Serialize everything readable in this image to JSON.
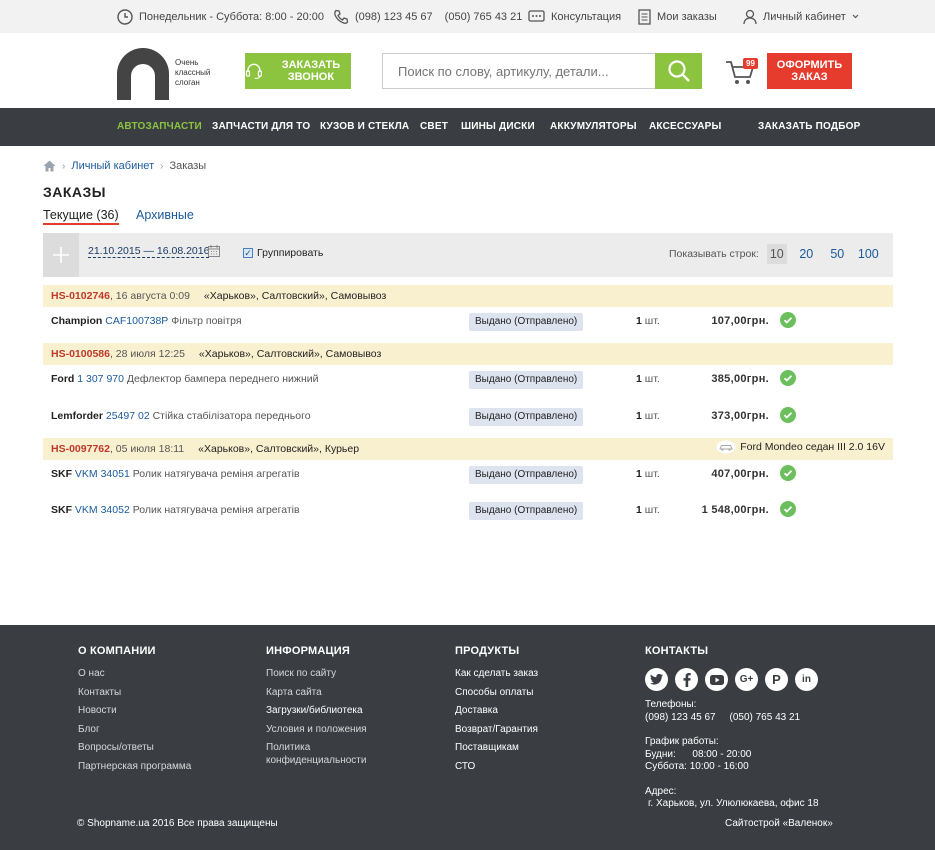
{
  "topbar": {
    "hours": "Понедельник - Суббота: 8:00 - 20:00",
    "phone1": "(098) 123 45 67",
    "phone2": "(050) 765 43 21",
    "consult": "Консультация",
    "my_orders": "Мои заказы",
    "account": "Личный кабинет"
  },
  "header": {
    "slogan": "Очень\nклассный\nслоган",
    "call_btn": "Заказать звонок",
    "search_placeholder": "Поиск по слову, артикулу, детали...",
    "cart_count": "99",
    "order_btn": "Оформить заказ"
  },
  "nav": {
    "items": [
      "АВТОЗАПЧАСТИ",
      "ЗАПЧАСТИ ДЛЯ ТО",
      "КУЗОВ И СТЕКЛА",
      "СВЕТ",
      "ШИНЫ ДИСКИ",
      "АККУМУЛЯТОРЫ",
      "АКСЕССУАРЫ"
    ],
    "right": "ЗАКАЗАТЬ ПОДБОР",
    "active_color": "#8cc43f"
  },
  "breadcrumb": {
    "home": "home",
    "account": "Личный кабинет",
    "current": "Заказы"
  },
  "page_title": "ЗАКАЗЫ",
  "tabs": {
    "current": "Текущие (36)",
    "archive": "Архивные"
  },
  "filter": {
    "date_range": "21.10.2015 — 16.08.2016",
    "group_label": "Группировать",
    "rows_label": "Показывать строк:",
    "rows_options": [
      "10",
      "20",
      "50",
      "100"
    ]
  },
  "orders": [
    {
      "num": "HS-0102746",
      "date": ", 16 августа 0:09",
      "addr": "«Харьков», Салтовский», Самовывоз",
      "car": "",
      "items": [
        {
          "brand": "Champion",
          "art": "CAF100738P",
          "desc": "Фільтр повітря",
          "status": "Выдано (Отправлено)",
          "qty": "1",
          "unit": "шт.",
          "price": "107,00грн."
        }
      ]
    },
    {
      "num": "HS-0100586",
      "date": ", 28 июля 12:25",
      "addr": "«Харьков», Салтовский», Самовывоз",
      "car": "",
      "items": [
        {
          "brand": "Ford",
          "art": "1 307 970",
          "desc": "Дефлектор бампера переднего нижний",
          "status": "Выдано (Отправлено)",
          "qty": "1",
          "unit": "шт.",
          "price": "385,00грн."
        },
        {
          "brand": "Lemforder",
          "art": "25497 02",
          "desc": "Стійка стабілізатора переднього",
          "status": "Выдано (Отправлено)",
          "qty": "1",
          "unit": "шт.",
          "price": "373,00грн."
        }
      ]
    },
    {
      "num": "HS-0097762",
      "date": ", 05 июля 18:11",
      "addr": "«Харьков», Салтовский», Курьер",
      "car": "Ford Mondeo седан III 2.0 16V",
      "items": [
        {
          "brand": "SKF",
          "art": "VKM 34051",
          "desc": "Ролик натягувача реміня агрегатів",
          "status": "Выдано (Отправлено)",
          "qty": "1",
          "unit": "шт.",
          "price": "407,00грн."
        },
        {
          "brand": "SKF",
          "art": "VKM 34052",
          "desc": "Ролик натягувача реміня агрегатів",
          "status": "Выдано (Отправлено)",
          "qty": "1",
          "unit": "шт.",
          "price": "1 548,00грн."
        }
      ]
    }
  ],
  "footer": {
    "company_title": "О КОМПАНИИ",
    "company_links": [
      "О нас",
      "Контакты",
      "Новости",
      "Блог",
      "Вопросы/ответы",
      "Партнерская программа"
    ],
    "info_title": "ИНФОРМАЦИЯ",
    "info_links": [
      "Поиск по сайту",
      "Карта сайта",
      "Загрузки/библиотека",
      "Условия и положения",
      "Политика конфиденциальности"
    ],
    "products_title": "ПРОДУКТЫ",
    "products_links": [
      "Как сделать заказ",
      "Способы оплаты",
      "Доставка",
      "Возврат/Гарантия",
      "Поставщикам",
      "СТО"
    ],
    "contacts_title": "КОНТАКТЫ",
    "phones_label": "Телефоны:",
    "phones": "(098) 123 45 67     (050) 765 43 21",
    "hours_label": "График работы:",
    "hours_weekdays": "Будни:      08:00 - 20:00",
    "hours_saturday": "Суббота: 10:00 - 16:00",
    "address_label": "Адрес:",
    "address": "г. Харьков, ул. Улюлюкаева, офис 18",
    "copyright": "© Shopname.ua 2016 Все права защищены",
    "studio": "Сайтострой «Валенок»"
  }
}
